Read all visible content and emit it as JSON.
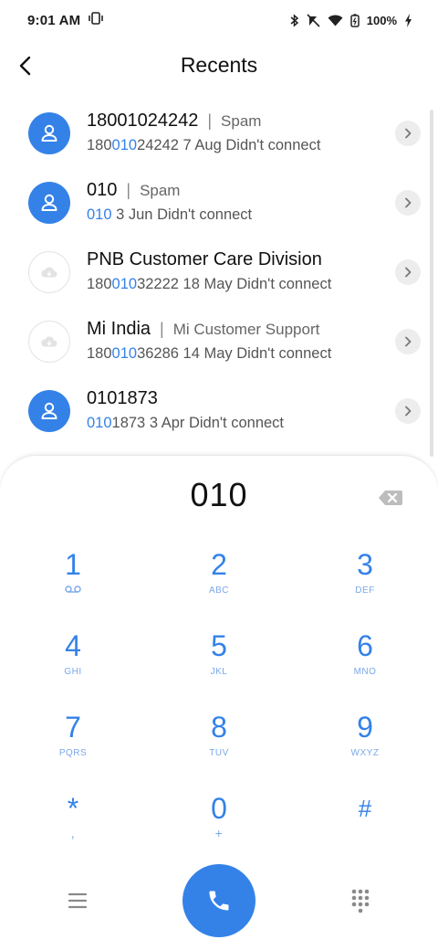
{
  "status_bar": {
    "time": "9:01 AM",
    "battery": "100%",
    "icons": [
      "vibrate-icon",
      "bluetooth-icon",
      "mute-icon",
      "wifi-icon",
      "battery-icon",
      "charging-icon"
    ]
  },
  "header": {
    "title": "Recents",
    "back_icon": "back-arrow-icon"
  },
  "recents": [
    {
      "title": "18001024242",
      "tag": "Spam",
      "number_prefix": "180",
      "number_match": "010",
      "number_suffix": "24242",
      "date": "7 Aug",
      "status": "Didn't connect",
      "avatar": "person-icon",
      "avatar_style": "filled"
    },
    {
      "title": "010",
      "tag": "Spam",
      "number_prefix": "",
      "number_match": "010",
      "number_suffix": "",
      "date": "3 Jun",
      "status": "Didn't connect",
      "avatar": "person-icon",
      "avatar_style": "filled"
    },
    {
      "title": "PNB Customer Care Division",
      "tag": "",
      "number_prefix": "180",
      "number_match": "010",
      "number_suffix": "32222",
      "date": "18 May",
      "status": "Didn't connect",
      "avatar": "cloud-icon",
      "avatar_style": "muted"
    },
    {
      "title": "Mi India",
      "tag": "Mi Customer Support",
      "number_prefix": "180",
      "number_match": "010",
      "number_suffix": "36286",
      "date": "14 May",
      "status": "Didn't connect",
      "avatar": "cloud-icon",
      "avatar_style": "muted"
    },
    {
      "title": "0101873",
      "tag": "",
      "number_prefix": "",
      "number_match": "010",
      "number_suffix": "1873",
      "date": "3 Apr",
      "status": "Didn't connect",
      "avatar": "person-icon",
      "avatar_style": "filled"
    }
  ],
  "dialpad": {
    "entered_number": "010",
    "keys": [
      {
        "digit": "1",
        "letters": "voicemail-icon"
      },
      {
        "digit": "2",
        "letters": "ABC"
      },
      {
        "digit": "3",
        "letters": "DEF"
      },
      {
        "digit": "4",
        "letters": "GHI"
      },
      {
        "digit": "5",
        "letters": "JKL"
      },
      {
        "digit": "6",
        "letters": "MNO"
      },
      {
        "digit": "7",
        "letters": "PQRS"
      },
      {
        "digit": "8",
        "letters": "TUV"
      },
      {
        "digit": "9",
        "letters": "WXYZ"
      },
      {
        "digit": "*",
        "letters": ","
      },
      {
        "digit": "0",
        "letters": "+"
      },
      {
        "digit": "#",
        "letters": ""
      }
    ]
  },
  "bottom_bar": {
    "menu_icon": "menu-icon",
    "call_icon": "phone-icon",
    "keypad_icon": "dialpad-icon"
  },
  "colors": {
    "accent": "#3482e8",
    "accent_light": "#7aa8ea",
    "text_primary": "#111111",
    "text_secondary": "#555555"
  }
}
